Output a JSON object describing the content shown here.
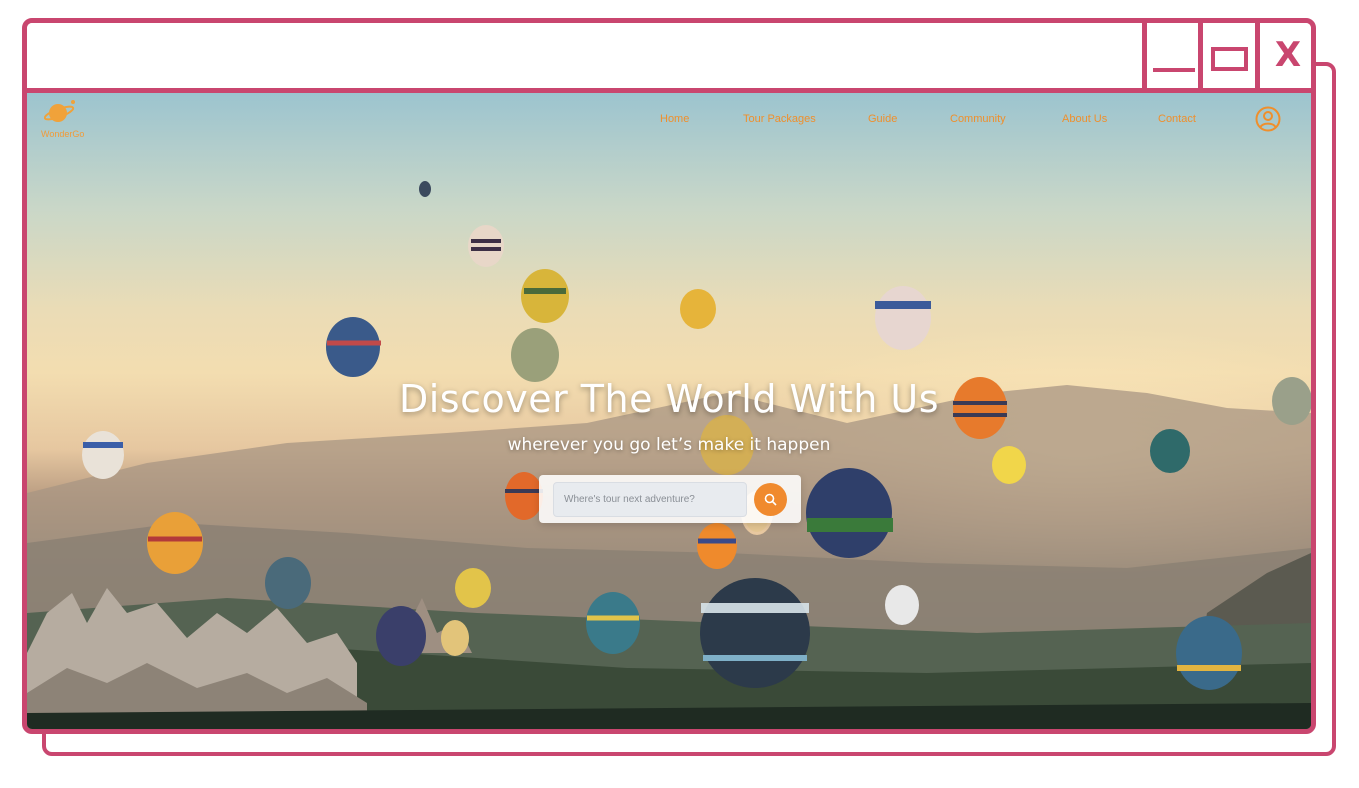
{
  "window": {
    "close_label": "X"
  },
  "brand": {
    "name": "WonderGo"
  },
  "nav": {
    "items": [
      {
        "label": "Home"
      },
      {
        "label": "Tour Packages"
      },
      {
        "label": "Guide"
      },
      {
        "label": "Community"
      },
      {
        "label": "About Us"
      },
      {
        "label": "Contact"
      }
    ]
  },
  "hero": {
    "title": "Discover The World With Us",
    "subtitle": "wherever you go let’s make it happen"
  },
  "search": {
    "placeholder": "Where's tour next adventure?",
    "value": ""
  },
  "icons": {
    "logo": "planet-icon",
    "user": "user-circle-icon",
    "search": "search-icon",
    "minimize": "minimize-icon",
    "maximize": "maximize-icon",
    "close": "close-icon"
  },
  "colors": {
    "frame": "#c9466f",
    "accent": "#f08a2e",
    "hero_text": "#ffffff"
  }
}
